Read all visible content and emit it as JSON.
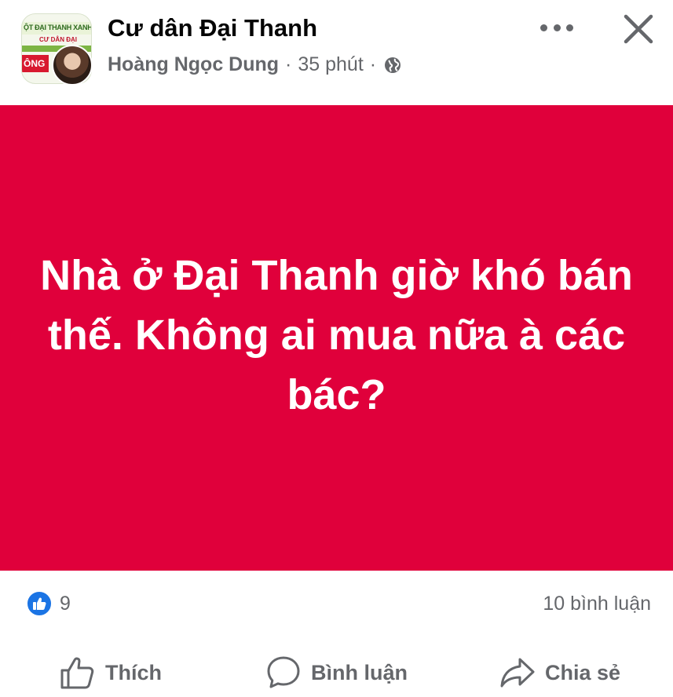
{
  "header": {
    "group_name": "Cư dân Đại Thanh",
    "author": "Hoàng Ngọc Dung",
    "time": "35 phút",
    "separator": "·",
    "privacy_icon": "globe-icon",
    "more_icon": "more-dots-icon",
    "close_icon": "close-icon"
  },
  "group_avatar": {
    "line1": "ỘT ĐẠI THANH XANH SẠCH",
    "line2": "CƯ DÂN ĐẠI",
    "line3": "ÔNG"
  },
  "post": {
    "background_color": "#e0003b",
    "text": "Nhà ở Đại Thanh giờ khó bán thế. Không ai mua nữa à các bác?"
  },
  "reactions": {
    "like_icon": "like-reaction-icon",
    "like_count": "9",
    "comment_count": "10 bình luận"
  },
  "actions": {
    "like_label": "Thích",
    "comment_label": "Bình luận",
    "share_label": "Chia sẻ"
  },
  "colors": {
    "accent_blue": "#1b74e4",
    "secondary_text": "#65676b",
    "primary_text": "#050505"
  }
}
